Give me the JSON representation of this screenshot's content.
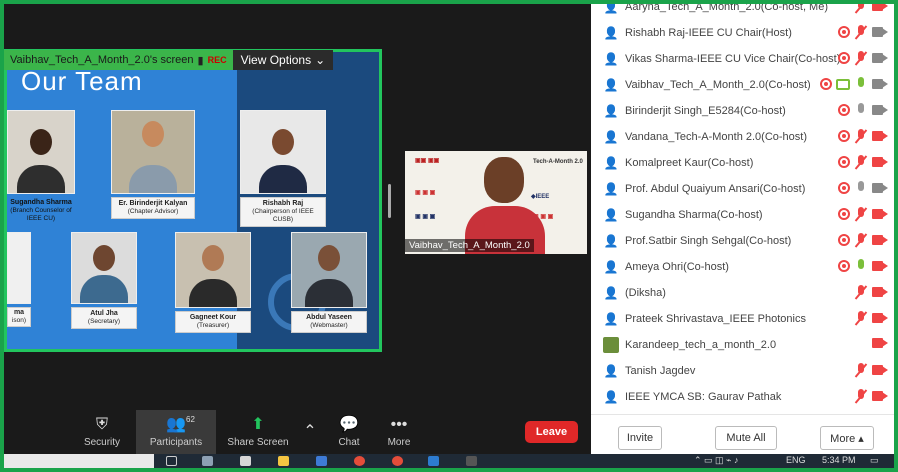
{
  "shared_screen": {
    "share_label": "Vaibhav_Tech_A_Month_2.0's screen",
    "rec_label": "REC",
    "view_options": "View Options",
    "slide_title": "Our Team",
    "members": [
      {
        "name": "Sugandha Sharma",
        "role": "(Branch Counselor of IEEE CU)"
      },
      {
        "name": "Er. Birinderjit Kalyan",
        "role": "(Chapter Advisor)"
      },
      {
        "name": "Rishabh Raj",
        "role": "(Chairperson of IEEE CUSB)"
      },
      {
        "name": "ma",
        "role": "ison)"
      },
      {
        "name": "Atul Jha",
        "role": "(Secretary)"
      },
      {
        "name": "Gagneet Kour",
        "role": "(Treasurer)"
      },
      {
        "name": "Abdul Yaseen",
        "role": "(Webmaster)"
      }
    ]
  },
  "webcam": {
    "name": "Vaibhav_Tech_A_Month_2.0",
    "banner_text": "Tech-A-Month 2.0"
  },
  "participants": [
    {
      "name": "Aaryna_Tech_A_Month_2.0(Co-host, Me)",
      "rec": false,
      "mic": "off",
      "video": "off",
      "screen": false
    },
    {
      "name": "Rishabh Raj-IEEE CU Chair(Host)",
      "rec": true,
      "mic": "off",
      "video": "on",
      "screen": false
    },
    {
      "name": "Vikas Sharma-IEEE CU Vice Chair(Co-host)",
      "rec": true,
      "mic": "off",
      "video": "on",
      "screen": false
    },
    {
      "name": "Vaibhav_Tech_A_Month_2.0(Co-host)",
      "rec": true,
      "mic": "on",
      "video": "on",
      "screen": true
    },
    {
      "name": "Birinderjit Singh_E5284(Co-host)",
      "rec": true,
      "mic": "grey",
      "video": "on",
      "screen": false
    },
    {
      "name": "Vandana_Tech-A-Month 2.0(Co-host)",
      "rec": true,
      "mic": "off",
      "video": "off",
      "screen": false
    },
    {
      "name": "Komalpreet Kaur(Co-host)",
      "rec": true,
      "mic": "off",
      "video": "off",
      "screen": false
    },
    {
      "name": "Prof. Abdul Quaiyum Ansari(Co-host)",
      "rec": true,
      "mic": "grey",
      "video": "on",
      "screen": false
    },
    {
      "name": "Sugandha Sharma(Co-host)",
      "rec": true,
      "mic": "off",
      "video": "off",
      "screen": false
    },
    {
      "name": "Prof.Satbir Singh Sehgal(Co-host)",
      "rec": true,
      "mic": "off",
      "video": "off",
      "screen": false
    },
    {
      "name": "Ameya Ohri(Co-host)",
      "rec": true,
      "mic": "on",
      "video": "off",
      "screen": false
    },
    {
      "name": "(Diksha)",
      "rec": false,
      "mic": "off",
      "video": "off",
      "screen": false
    },
    {
      "name": "Prateek Shrivastava_IEEE Photonics",
      "rec": false,
      "mic": "off",
      "video": "off",
      "screen": false
    },
    {
      "name": "Karandeep_tech_a_month_2.0",
      "rec": false,
      "mic": "none",
      "video": "off",
      "screen": false,
      "avatar_img": true
    },
    {
      "name": "Tanish Jagdev",
      "rec": false,
      "mic": "off",
      "video": "off",
      "screen": false
    },
    {
      "name": "IEEE YMCA SB: Gaurav Pathak",
      "rec": false,
      "mic": "off",
      "video": "off",
      "screen": false
    }
  ],
  "panel_buttons": {
    "invite": "Invite",
    "mute_all": "Mute All",
    "more": "More ▴"
  },
  "toolbar": {
    "security": "Security",
    "participants": "Participants",
    "participants_count": "62",
    "share_screen": "Share Screen",
    "chat": "Chat",
    "more": "More",
    "leave": "Leave"
  },
  "taskbar": {
    "lang": "ENG",
    "time": "5:34 PM"
  },
  "colors": {
    "accent_green": "#22c55e",
    "leave_red": "#e02828",
    "slide_blue": "#2f82d6"
  }
}
